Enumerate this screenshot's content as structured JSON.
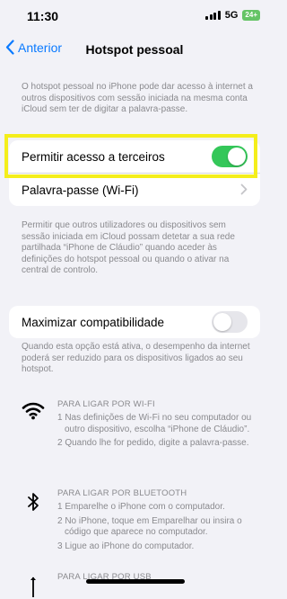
{
  "status_bar": {
    "time": "11:30",
    "network": "5G",
    "battery": "24+"
  },
  "nav": {
    "back_label": "Anterior",
    "title": "Hotspot pessoal"
  },
  "intro_text": "O hotspot pessoal no iPhone pode dar acesso à internet a outros dispositivos com sessão iniciada na mesma conta iCloud sem ter de digitar a palavra-passe.",
  "settings": {
    "allow_others_label": "Permitir acesso a terceiros",
    "allow_others_on": true,
    "password_label": "Palavra-passe (Wi-Fi)"
  },
  "allow_text": "Permitir que outros utilizadores ou dispositivos sem sessão iniciada em iCloud possam detetar a sua rede partilhada “iPhone de Cláudio” quando aceder às definições do hotspot pessoal ou quando o ativar na central de controlo.",
  "compat": {
    "label": "Maximizar compatibilidade",
    "on": false,
    "note": "Quando esta opção está ativa, o desempenho da internet poderá ser reduzido para os dispositivos ligados ao seu hotspot."
  },
  "wifi_section": {
    "title": "PARA LIGAR POR WI-FI",
    "steps": [
      "1 Nas definições de Wi-Fi no seu computador ou outro dispositivo, escolha “iPhone de Cláudio”.",
      "2 Quando lhe for pedido, digite a palavra-passe."
    ]
  },
  "bluetooth_section": {
    "title": "PARA LIGAR POR BLUETOOTH",
    "steps": [
      "1 Emparelhe o iPhone com o computador.",
      "2 No iPhone, toque em Emparelhar ou insira o código que aparece no computador.",
      "3 Ligue ao iPhone do computador."
    ]
  },
  "usb_section": {
    "title": "PARA LIGAR POR USB"
  },
  "icons": {
    "back": "chevron-left-icon",
    "row": "chevron-right-icon",
    "wifi": "wifi-icon",
    "bluetooth": "bluetooth-icon",
    "usb": "usb-icon"
  },
  "colors": {
    "accent": "#0a7aff",
    "toggle_on": "#34c759",
    "highlight": "#f4ee1b",
    "background": "#f2f2f7"
  }
}
